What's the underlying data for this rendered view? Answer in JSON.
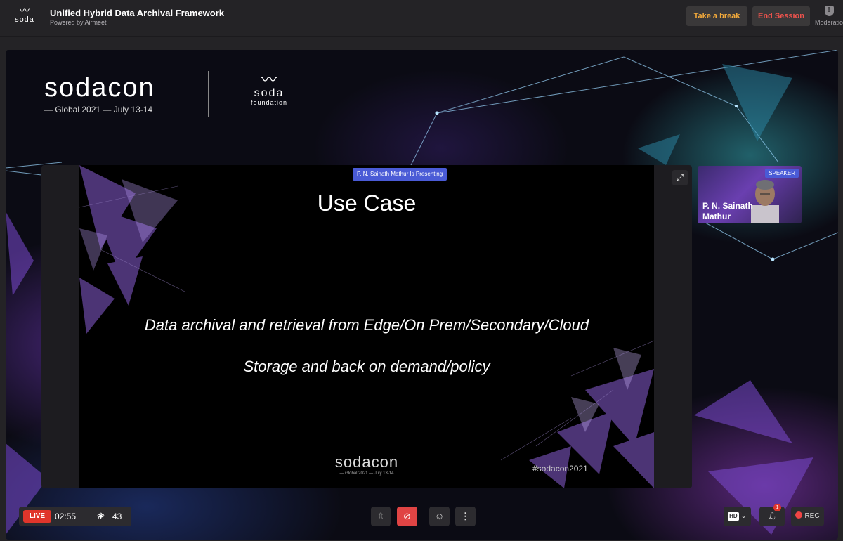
{
  "header": {
    "logo_text": "soda",
    "title": "Unified Hybrid Data Archival Framework",
    "subtitle": "Powered by Airmeet",
    "take_break_label": "Take a break",
    "end_session_label": "End Session",
    "moderation_label": "Moderation"
  },
  "stage": {
    "brand_name": "sodacon",
    "brand_sub": "— Global 2021 — July 13-14",
    "foundation_word": "soda",
    "foundation_sub": "foundation"
  },
  "presentation": {
    "presenting_label": "P. N. Sainath Mathur Is Presenting",
    "slide_title": "Use Case",
    "slide_line1": "Data archival and retrieval from Edge/On Prem/Secondary/Cloud",
    "slide_line2": "Storage and back on demand/policy",
    "footer_logo": "sodacon",
    "footer_sub": "— Global 2021 — July 13-14",
    "hashtag": "#sodacon2021"
  },
  "speaker": {
    "tag": "SPEAKER",
    "name": "P. N. Sainath Mathur"
  },
  "controls": {
    "live_label": "LIVE",
    "timer": "02:55",
    "attendees": "43",
    "hd_label": "HD",
    "feed_badge": "1",
    "rec_label": "REC"
  },
  "colors": {
    "live": "#e0352b",
    "break_text": "#f2a93b",
    "end_text": "#f0534d",
    "presenting_badge": "#4a5bd6",
    "cam_off": "#e04444"
  }
}
